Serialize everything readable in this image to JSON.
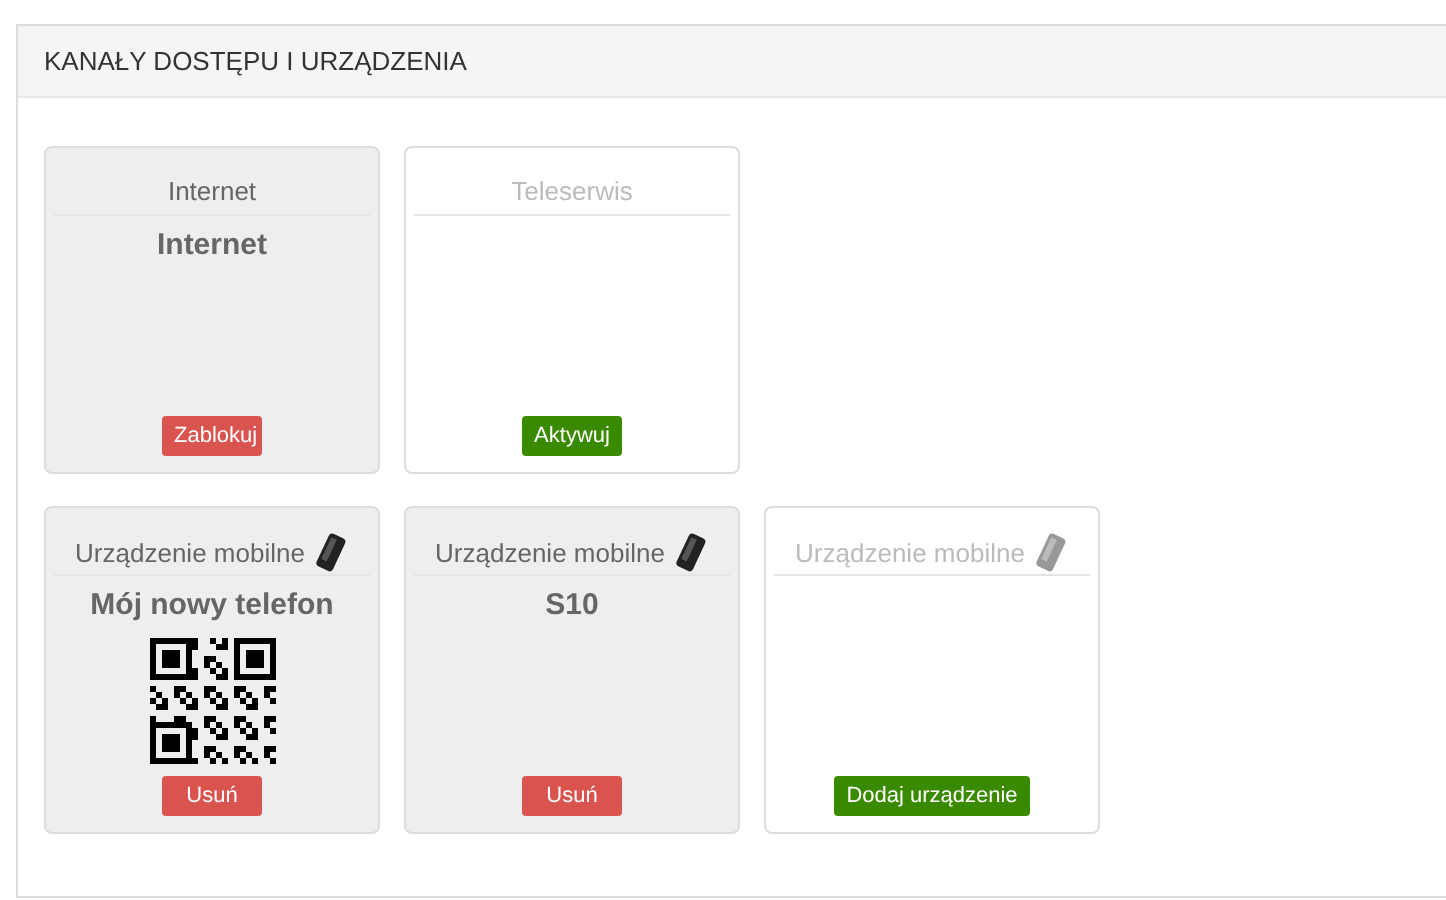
{
  "panel": {
    "title": "KANAŁY DOSTĘPU I URZĄDZENIA"
  },
  "rows": [
    [
      {
        "title": "Internet",
        "active": true,
        "kind": "channel",
        "name": "Internet",
        "qr_code": false,
        "button": {
          "label": "Zablokuj",
          "kind": "danger"
        }
      },
      {
        "title": "Teleserwis",
        "active": false,
        "kind": "channel",
        "qr_code": false,
        "button": {
          "label": "Aktywuj",
          "kind": "success"
        }
      }
    ],
    [
      {
        "title": "Urządzenie mobilne",
        "active": true,
        "kind": "mobile",
        "name": "Mój nowy telefon",
        "qr_code": true,
        "button": {
          "label": "Usuń",
          "kind": "danger"
        }
      },
      {
        "title": "Urządzenie mobilne",
        "active": true,
        "kind": "mobile",
        "name": "S10",
        "qr_code": false,
        "button": {
          "label": "Usuń",
          "kind": "danger"
        }
      },
      {
        "title": "Urządzenie mobilne",
        "active": false,
        "kind": "mobile",
        "qr_code": false,
        "button": {
          "label": "Dodaj urządzenie",
          "kind": "success"
        }
      }
    ]
  ]
}
